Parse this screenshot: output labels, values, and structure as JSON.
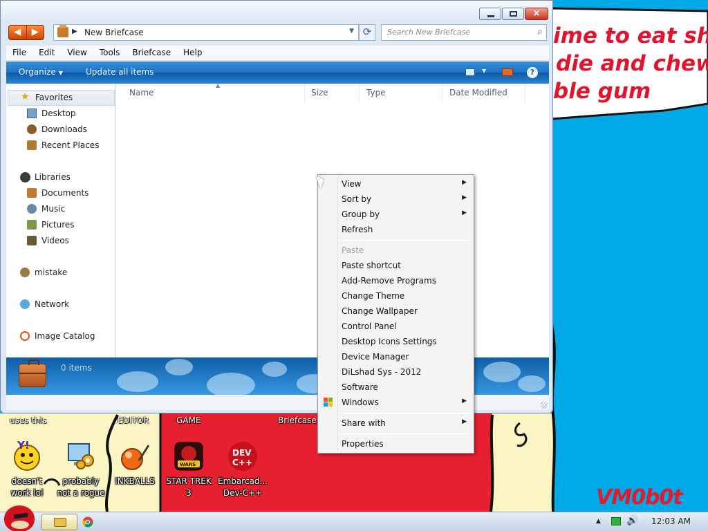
{
  "wallpaper": {
    "speech_lines": [
      "ime to eat shit",
      "die and chew",
      "ble gum"
    ],
    "panel_labels": [
      "uses this",
      "EDITOR",
      "GAME",
      "Briefcase"
    ],
    "signature": "VM0b0t",
    "colors": {
      "sky": "#00a9e6",
      "red": "#e7202f",
      "cream": "#fbf4c3",
      "text_red": "#e0142c"
    }
  },
  "desktop_icons": [
    {
      "label": "doesn't work lol",
      "icon": "yahoo-messenger-icon"
    },
    {
      "label": "probably not a rogue",
      "icon": "computer-gears-icon"
    },
    {
      "label": "INKBALLS",
      "icon": "inkball-icon"
    },
    {
      "label": "STAR TREK 3",
      "icon": "star-wars-icon"
    },
    {
      "label": "Embarcad... Dev-C++",
      "icon": "devcpp-icon"
    }
  ],
  "window": {
    "breadcrumb": "New Briefcase",
    "search_placeholder": "Search New Briefcase",
    "menu": [
      "File",
      "Edit",
      "View",
      "Tools",
      "Briefcase",
      "Help"
    ],
    "toolbar": {
      "organize": "Organize",
      "update_all": "Update all items"
    },
    "columns": [
      "Name",
      "Size",
      "Type",
      "Date Modified"
    ],
    "nav": {
      "favorites": "Favorites",
      "favorites_items": [
        "Desktop",
        "Downloads",
        "Recent Places"
      ],
      "libraries": "Libraries",
      "libraries_items": [
        "Documents",
        "Music",
        "Pictures",
        "Videos"
      ],
      "mistake": "mistake",
      "network": "Network",
      "image_catalog": "Image Catalog"
    },
    "details": {
      "count": "0 items"
    }
  },
  "context_menu": {
    "items": [
      {
        "label": "View",
        "submenu": true
      },
      {
        "label": "Sort by",
        "submenu": true
      },
      {
        "label": "Group by",
        "submenu": true
      },
      {
        "label": "Refresh"
      },
      {
        "label": "Paste",
        "disabled": true
      },
      {
        "label": "Paste shortcut"
      },
      {
        "label": "Add-Remove Programs"
      },
      {
        "label": "Change Theme"
      },
      {
        "label": "Change Wallpaper"
      },
      {
        "label": "Control Panel"
      },
      {
        "label": "Desktop Icons Settings"
      },
      {
        "label": "Device Manager"
      },
      {
        "label": "DiLshad Sys - 2012"
      },
      {
        "label": "Software"
      },
      {
        "label": "Windows",
        "submenu": true,
        "icon": "windows-flag-icon"
      },
      {
        "label": "Share with",
        "submenu": true
      },
      {
        "label": "Properties"
      }
    ]
  },
  "taskbar": {
    "clock": "12:03 AM"
  }
}
